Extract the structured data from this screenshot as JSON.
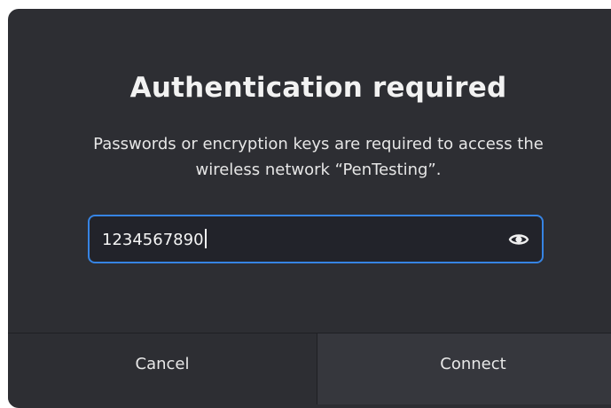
{
  "dialog": {
    "title": "Authentication required",
    "message": "Passwords or encryption keys are required to access the wireless network “PenTesting”.",
    "password_field": {
      "value": "1234567890",
      "reveal_icon": "eye-icon"
    },
    "buttons": {
      "cancel": "Cancel",
      "connect": "Connect"
    }
  },
  "colors": {
    "dialog_bg": "#2d2e33",
    "focus_border": "#3684e3",
    "text": "#f2f2f2"
  }
}
